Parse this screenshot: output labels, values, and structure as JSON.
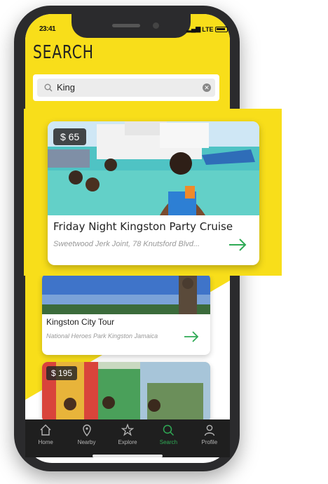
{
  "status": {
    "time": "23:41",
    "signal": "LTE"
  },
  "header": {
    "title": "SEARCH"
  },
  "search": {
    "value": "King"
  },
  "featured": {
    "price": "$ 65",
    "name": "Friday Night Kingston Party Cruise",
    "address": "Sweetwood Jerk Joint, 78 Knutsford Blvd..."
  },
  "results": [
    {
      "name": "Kingston City Tour",
      "address": "National Heroes Park Kingston Jamaica",
      "price": ""
    },
    {
      "name": "",
      "address": "",
      "price": "$ 195"
    }
  ],
  "tabs": [
    {
      "label": "Home",
      "icon": "home-icon",
      "active": false
    },
    {
      "label": "Nearby",
      "icon": "location-pin-icon",
      "active": false
    },
    {
      "label": "Explore",
      "icon": "star-icon",
      "active": false
    },
    {
      "label": "Search",
      "icon": "search-icon",
      "active": true
    },
    {
      "label": "Profile",
      "icon": "user-icon",
      "active": false
    }
  ],
  "colors": {
    "accent": "#f8de1a",
    "active_tab": "#2faa55",
    "arrow": "#2faa55"
  }
}
